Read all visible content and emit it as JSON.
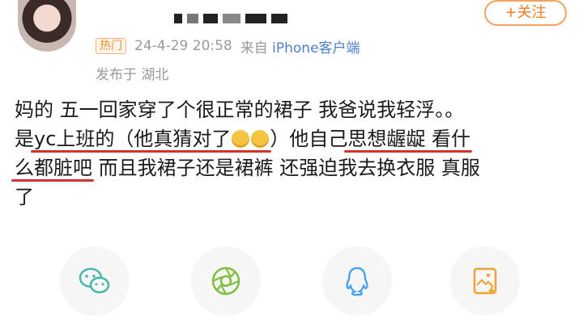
{
  "header": {
    "follow_label": "+关注",
    "hot_badge": "热门",
    "timestamp": "24-4-29 20:58",
    "source_prefix": "来自",
    "source_device": "iPhone客户端",
    "location": "发布于 湖北"
  },
  "post": {
    "line1": "妈的 五一回家穿了个很正常的裙子 我爸说我轻浮。。",
    "line2_a": "是",
    "line2_b": "yc上班的（他真猜对了",
    "line2_c": "）他自己",
    "line2_d": "思想龌龊 看什",
    "line3_a": "么都脏吧",
    "line3_b": " 而且我裙子还是裙裤 还强迫我去换衣服 真服",
    "line4": "了"
  },
  "share": {
    "icons": [
      "wechat-icon",
      "moments-icon",
      "qq-icon",
      "save-image-icon"
    ]
  },
  "colors": {
    "accent": "#f27c1b",
    "underline": "#d4322f",
    "link": "#4e7ec9",
    "meta": "#9a9a9a"
  }
}
